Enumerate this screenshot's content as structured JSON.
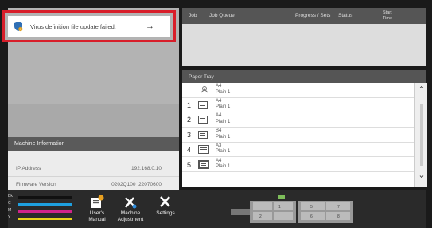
{
  "notification": {
    "message": "Virus definition file update failed.",
    "arrow": "→"
  },
  "machine_info": {
    "title": "Machine Information",
    "rows": [
      {
        "label": "IP Address",
        "value": "192.168.0.10"
      },
      {
        "label": "Firmware Version",
        "value": "0202Q100_22070600"
      }
    ]
  },
  "job_queue": {
    "columns": [
      "Job",
      "Job Queue",
      "Progress / Sets",
      "Status",
      "Start",
      "Time"
    ]
  },
  "paper_tray": {
    "title": "Paper Tray",
    "rows": [
      {
        "num": "",
        "size": "A4",
        "type": "Plain 1",
        "icon": "bypass-tray-icon"
      },
      {
        "num": "1",
        "size": "A4",
        "type": "Plain 1",
        "icon": "tray-icon"
      },
      {
        "num": "2",
        "size": "A4",
        "type": "Plain 1",
        "icon": "tray-icon"
      },
      {
        "num": "3",
        "size": "B4",
        "type": "Plain 1",
        "icon": "tray-icon"
      },
      {
        "num": "4",
        "size": "A3",
        "type": "Plain 1",
        "icon": "tray-icon"
      },
      {
        "num": "5",
        "size": "A4",
        "type": "Plain 1",
        "icon": "large-tray-icon"
      }
    ]
  },
  "toner": [
    {
      "label": "Bk",
      "color": "#111111",
      "level": 0.85
    },
    {
      "label": "C",
      "color": "#1ea0e0",
      "level": 0.85
    },
    {
      "label": "M",
      "color": "#d0238a",
      "level": 0.85
    },
    {
      "label": "Y",
      "color": "#e8d21a",
      "level": 0.85
    }
  ],
  "buttons": {
    "manual": "User's\nManual",
    "machine_adjustment": "Machine\nAdjustment",
    "settings": "Settings"
  },
  "colors": {
    "alert_border": "#d81e2a",
    "header_bg": "#555555"
  }
}
